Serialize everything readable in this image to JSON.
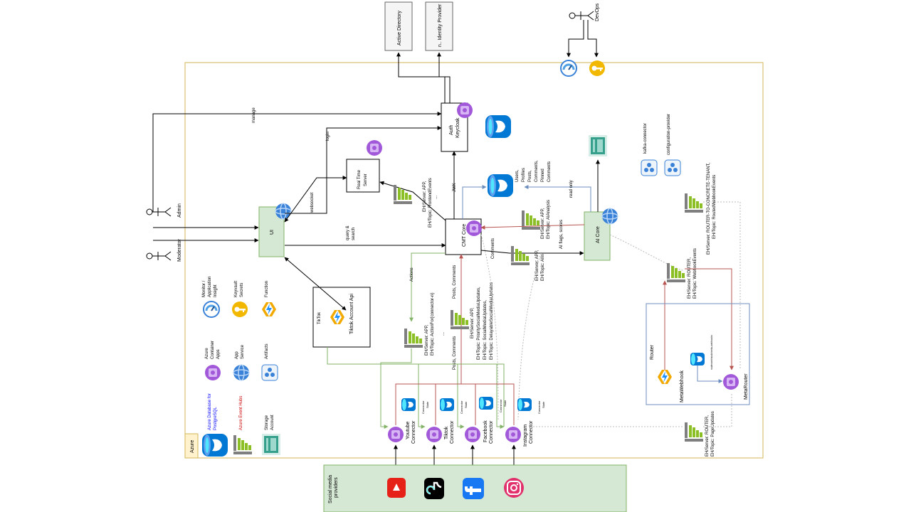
{
  "actors": {
    "devops": "DevOps",
    "admin": "Admin",
    "moderator": "Moderator"
  },
  "external": {
    "active_directory": "Active Directory",
    "identity_provider": "n.. Identity Provider"
  },
  "azure_tag": "Azure",
  "components": {
    "ui": "UI",
    "realtime_server": "Real Time Server",
    "auth_line1": "Auth",
    "auth_line2": "Keycloak",
    "cmt_core": "CMT Core",
    "ai_core": "AI Core",
    "tiktok_title": "TikTok",
    "tiktok_api": "Tiktok Account Api",
    "kafka_connector": "kafka-connector",
    "config_provider": "configuration-provider"
  },
  "db": {
    "users_lines": [
      "Users,",
      "Profiles",
      "Posts,",
      "Comments,",
      "Pinned",
      "Comments"
    ]
  },
  "edge_labels": {
    "manage": "manage",
    "login": "login",
    "websocket": "websocket",
    "query_search_1": "query &",
    "query_search_2": "search",
    "jwk": "JWK",
    "read_only": "read only",
    "comments": "Comments",
    "ai_flags_1": "AI flags, scores",
    "actions": "Actions",
    "posts_comments_1": "Posts, Comments",
    "posts_comments_2": "Posts, Comments",
    "ellipsis": "...",
    "ellipsis2": "...",
    "routerwebhook": "routerwebhook/meta-webhooks"
  },
  "event_hubs": {
    "frontend_1": "EH/Server: APP,",
    "frontend_2": "EH/Topic: FrontendEvents",
    "aianalysis_1": "EH/Server: APP,",
    "aianalysis_2": "EH/Topic: AIAnalysis",
    "aiin_1": "EH/Server: APP,",
    "aiin_2": "EH/Topic: AIIn",
    "action_1": "EH/Server: APP,",
    "action_2": "EH/Topic: ActionFor{connector-n}",
    "social_1": "EH/Server: APP,",
    "social_2": "EH/Topic: PrioritySocialMediaUpdates,",
    "social_3": "EH/Topic: SocialMediaUpdates,",
    "social_4": "EH/Topic: DelayableSocialMediaUpdates",
    "route_tenant_1": "EH/Server: ROUTER-TO-CONCRETE-TENANT,",
    "route_tenant_2": "EH/Topic: RoutedWebhookEvents",
    "webhook_1": "EH/Server: ROUTER,",
    "webhook_2": "EH/Topic: WebhookEvents",
    "page_1": "EH/Server: ROUTER,",
    "page_2": "EH/Topic: PageUpdates"
  },
  "router": {
    "title": "Router",
    "meta_webhook": "MetaWebhook",
    "meta_router": "MetaRouter"
  },
  "connectors": [
    {
      "line1": "Youtube",
      "line2": "Connector",
      "state_1": "Connector",
      "state_2": "State"
    },
    {
      "line1": "Tiktok",
      "line2": "Connector",
      "state_1": "Connector",
      "state_2": "State"
    },
    {
      "line1": "Facebook",
      "line2": "Connector",
      "state_1": "Connector",
      "state_2": "State"
    },
    {
      "line1": "Instagram",
      "line2": "Connector",
      "state_1": "Connector",
      "state_2": "State"
    }
  ],
  "social": {
    "line1": "Social media",
    "line2": "providers"
  },
  "legend": {
    "monitor": [
      "Monitor /",
      "Application",
      "Insight"
    ],
    "keyvault": [
      "Keyvault",
      "Secrets"
    ],
    "function": [
      "Function"
    ],
    "container_apps": [
      "Azure",
      "Container",
      "Apps"
    ],
    "app_service": [
      "App",
      "Service"
    ],
    "artifacts": [
      "Artifacts"
    ],
    "postgres": [
      "Azure Database for",
      "PostgreSQL"
    ],
    "eventhubs": [
      "Azure Event Hubs"
    ],
    "storage": [
      "Storage",
      "Account"
    ]
  },
  "colors": {
    "green": "#82b366",
    "red": "#b85450",
    "blue": "#6c8ebf",
    "purple": "#a259d9",
    "postgres": "#0078d4",
    "azure_border": "#d6b656"
  }
}
